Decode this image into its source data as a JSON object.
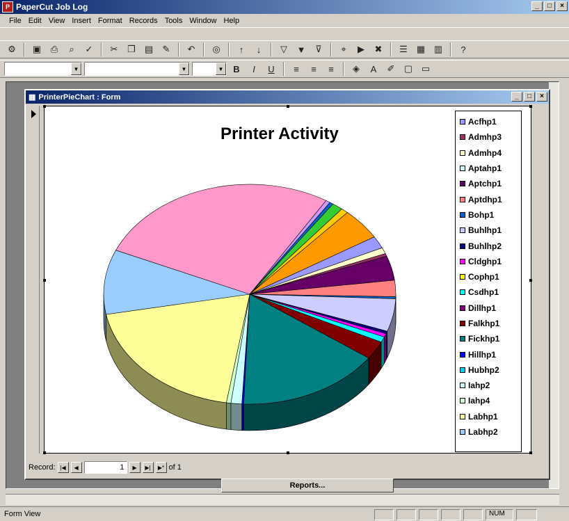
{
  "app": {
    "title": "PaperCut Job Log",
    "icon": "papercut-icon"
  },
  "window_buttons": [
    "_",
    "□",
    "×"
  ],
  "menu": [
    "File",
    "Edit",
    "View",
    "Insert",
    "Format",
    "Records",
    "Tools",
    "Window",
    "Help"
  ],
  "form": {
    "title": "PrinterPieChart : Form"
  },
  "record": {
    "label": "Record:",
    "current": "1",
    "of": "of  1"
  },
  "reports_button": "Reports...",
  "status": {
    "mode": "Form View",
    "num": "NUM"
  },
  "colors": {
    "title_bar": "#0a246a",
    "chrome": "#d4d0c8"
  },
  "chart_data": {
    "type": "pie",
    "title": "Printer Activity",
    "legend_position": "right",
    "categories": [
      "Acfhp1",
      "Admhp3",
      "Admhp4",
      "Aptahp1",
      "Aptchp1",
      "Aptdhp1",
      "Bohp1",
      "Buhlhp1",
      "Buhlhp2",
      "Cldghp1",
      "Cophp1",
      "Csdhp1",
      "Dillhp1",
      "Falkhp1",
      "Fickhp1",
      "Hillhp1",
      "Hubhp2",
      "Iahp2",
      "Iahp4",
      "Labhp1",
      "Labhp2"
    ],
    "colors": [
      "#9999ff",
      "#993366",
      "#ffffcc",
      "#ccffff",
      "#660066",
      "#ff8080",
      "#0066cc",
      "#ccccff",
      "#000080",
      "#ff00ff",
      "#ffff00",
      "#00ffff",
      "#800080",
      "#800000",
      "#008080",
      "#0000ff",
      "#00ccff",
      "#ccffff",
      "#ccffcc",
      "#ffff99",
      "#99ccff"
    ],
    "values": [
      1.8,
      0.4,
      0.9,
      0.2,
      3.6,
      2.4,
      0.3,
      4.8,
      0.4,
      0.5,
      0.3,
      0.8,
      0.3,
      2.7,
      15.8,
      0.2,
      0.2,
      1.2,
      0.5,
      19.5,
      9.5
    ],
    "extra_slices": [
      {
        "color": "#ff99cc",
        "value": 27.2
      },
      {
        "color": "#cc99ff",
        "value": 0.5
      },
      {
        "color": "#0066cc",
        "value": 0.4
      },
      {
        "color": "#33cc33",
        "value": 1.2
      },
      {
        "color": "#ffcc00",
        "value": 0.8
      },
      {
        "color": "#ff9900",
        "value": 4.6
      }
    ]
  }
}
